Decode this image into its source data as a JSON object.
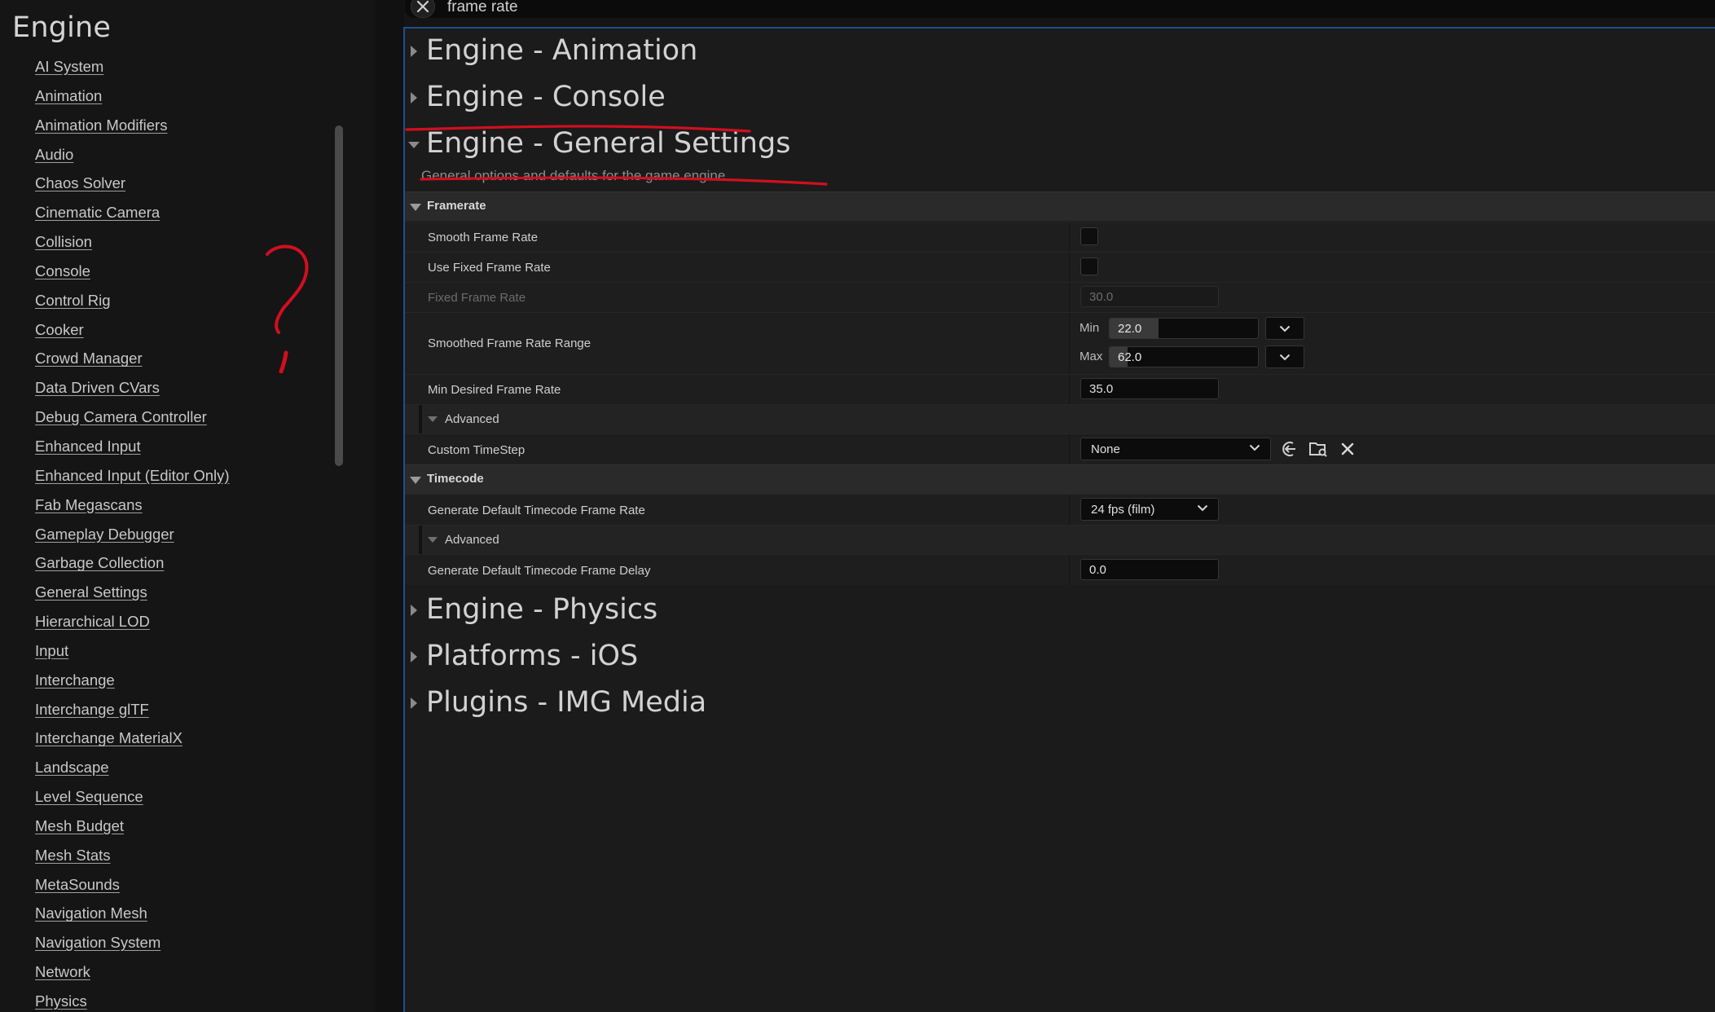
{
  "sidebar": {
    "title": "Engine",
    "items": [
      "AI System",
      "Animation",
      "Animation Modifiers",
      "Audio",
      "Chaos Solver",
      "Cinematic Camera",
      "Collision",
      "Console",
      "Control Rig",
      "Cooker",
      "Crowd Manager",
      "Data Driven CVars",
      "Debug Camera Controller",
      "Enhanced Input",
      "Enhanced Input (Editor Only)",
      "Fab Megascans",
      "Gameplay Debugger",
      "Garbage Collection",
      "General Settings",
      "Hierarchical LOD",
      "Input",
      "Interchange",
      "Interchange glTF",
      "Interchange MaterialX",
      "Landscape",
      "Level Sequence",
      "Mesh Budget",
      "Mesh Stats",
      "MetaSounds",
      "Navigation Mesh",
      "Navigation System",
      "Network",
      "Physics"
    ]
  },
  "search": {
    "value": "frame rate",
    "clear_icon": "close-icon"
  },
  "categories": {
    "animation": "Engine - Animation",
    "console": "Engine - Console",
    "general": "Engine - General Settings",
    "general_description": "General options and defaults for the game engine.",
    "physics": "Engine - Physics",
    "ios": "Platforms - iOS",
    "img_media": "Plugins - IMG Media"
  },
  "framerate": {
    "header": "Framerate",
    "smooth_frame_rate": {
      "label": "Smooth Frame Rate",
      "checked": false
    },
    "use_fixed_frame_rate": {
      "label": "Use Fixed Frame Rate",
      "checked": false
    },
    "fixed_frame_rate": {
      "label": "Fixed Frame Rate",
      "value": "30.0"
    },
    "smoothed_range": {
      "label": "Smoothed Frame Rate Range",
      "min_label": "Min",
      "min_value": "22.0",
      "max_label": "Max",
      "max_value": "62.0"
    },
    "min_desired": {
      "label": "Min Desired Frame Rate",
      "value": "35.0"
    },
    "advanced_label": "Advanced",
    "custom_timestep": {
      "label": "Custom TimeStep",
      "value": "None"
    }
  },
  "timecode": {
    "header": "Timecode",
    "default_frame_rate": {
      "label": "Generate Default Timecode Frame Rate",
      "value": "24 fps (film)"
    },
    "advanced_label": "Advanced",
    "default_frame_delay": {
      "label": "Generate Default Timecode Frame Delay",
      "value": "0.0"
    }
  },
  "colors": {
    "background": "#151515",
    "panel": "#1b1b1b",
    "accent_blue": "#1f4f8a",
    "annotation_red": "#d10f1f"
  }
}
